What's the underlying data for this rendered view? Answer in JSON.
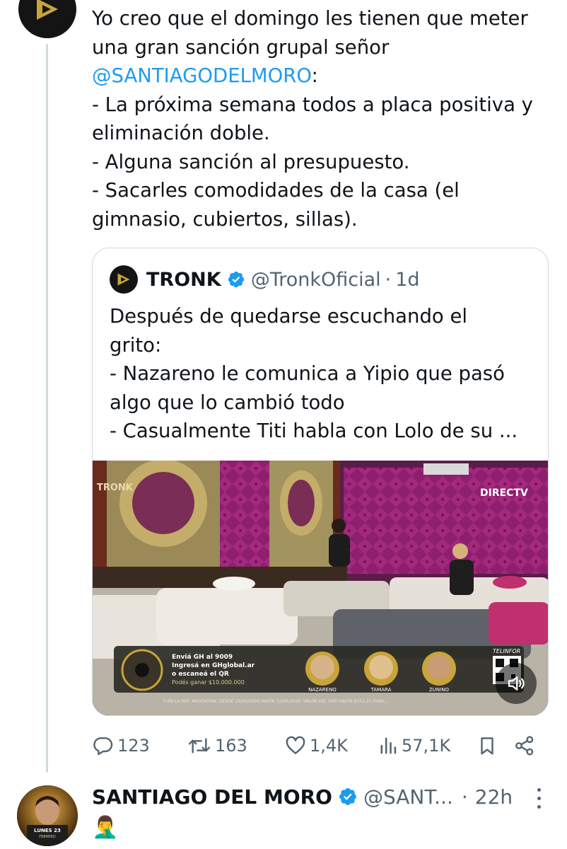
{
  "tweet": {
    "lines": [
      "Yo creo que el domingo les tienen que meter",
      "una gran sanción grupal señor",
      "- La próxima semana todos a placa positiva y",
      "eliminación doble.",
      "- Alguna sanción al presupuesto.",
      "- Sacarles comodidades de la casa (el",
      "gimnasio, cubiertos, sillas)."
    ],
    "mention": "@SANTIAGODELMORO",
    "mention_suffix": ":"
  },
  "quote": {
    "name": "TRONK",
    "handle": "@TronkOficial",
    "separator": "·",
    "time": "1d",
    "lines": [
      "Después de quedarse escuchando el",
      "grito:",
      "- Nazareno le comunica a Yipio que pasó",
      "algo que lo cambió todo",
      "- Casualmente Titi habla con Lolo de su ..."
    ],
    "media": {
      "watermark": "TRONK",
      "channel": "DIRECTV",
      "banner_lines": [
        "Enviá GH al 9009",
        "Ingresá en GHglobal.ar",
        "o escaneá el QR",
        "Podés ganar $10.000.000"
      ],
      "nominees": [
        "NAZARENO",
        "TAMARA",
        "ZUNINO"
      ],
      "sponsor": "TELINFOR",
      "disclaimer": "0 EN LA REP. ARGENTINA. DESDE 23/02/2026 HASTA 31/05/2026. VALOR DEL SMS HASTA $353,21 FINAL..."
    }
  },
  "actions": {
    "replies": "123",
    "reposts": "163",
    "likes": "1,4K",
    "views": "57,1K"
  },
  "next_tweet": {
    "name": "SANTIAGO DEL MORO",
    "handle": "@SANT...",
    "separator": "·",
    "time": "22h",
    "emoji": "🤦‍♂️",
    "avatar_lines": [
      "LUNES 23",
      "FEBRERO"
    ]
  },
  "colors": {
    "link": "#1d9bf0",
    "secondary_text": "#536471",
    "border": "#cfd9de",
    "verified": "#1d9bf0"
  },
  "icons": [
    "reply-icon",
    "repost-icon",
    "like-icon",
    "views-icon",
    "bookmark-icon",
    "share-icon",
    "verified-icon",
    "volume-icon",
    "more-icon"
  ]
}
